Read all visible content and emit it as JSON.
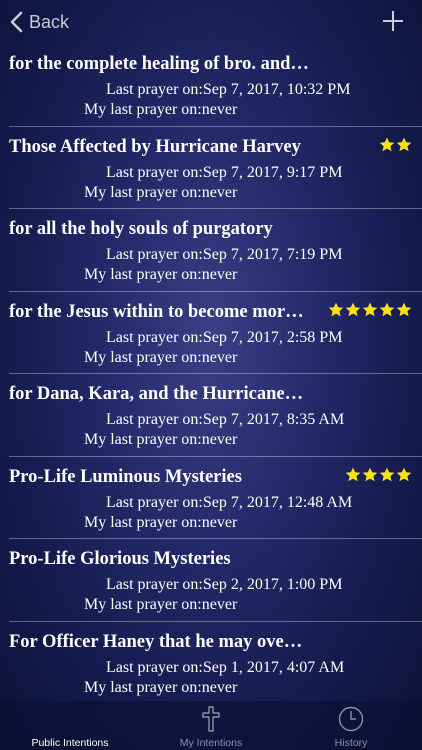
{
  "nav": {
    "back_label": "Back"
  },
  "colors": {
    "star": "#f7e21a",
    "muted": "#8d90a8"
  },
  "intentions": [
    {
      "title": "for the complete healing of bro. and…",
      "stars": 0,
      "last_prayer": "Last prayer on:Sep 7, 2017, 10:32 PM",
      "my_last_prayer": "My last prayer on:never"
    },
    {
      "title": "Those Affected by Hurricane Harvey",
      "stars": 2,
      "last_prayer": "Last prayer on:Sep 7, 2017, 9:17 PM",
      "my_last_prayer": "My last prayer on:never"
    },
    {
      "title": "for all the holy souls of purgatory",
      "stars": 0,
      "last_prayer": "Last prayer on:Sep 7, 2017, 7:19 PM",
      "my_last_prayer": "My last prayer on:never"
    },
    {
      "title": "for the Jesus within to become mor…",
      "stars": 5,
      "last_prayer": "Last prayer on:Sep 7, 2017, 2:58 PM",
      "my_last_prayer": "My last prayer on:never"
    },
    {
      "title": "for Dana, Kara, and the Hurricane…",
      "stars": 0,
      "last_prayer": "Last prayer on:Sep 7, 2017, 8:35 AM",
      "my_last_prayer": "My last prayer on:never"
    },
    {
      "title": "Pro-Life Luminous Mysteries",
      "stars": 4,
      "last_prayer": "Last prayer on:Sep 7, 2017, 12:48 AM",
      "my_last_prayer": "My last prayer on:never"
    },
    {
      "title": "Pro-Life Glorious Mysteries",
      "stars": 0,
      "last_prayer": "Last prayer on:Sep 2, 2017, 1:00 PM",
      "my_last_prayer": "My last prayer on:never"
    },
    {
      "title": "For Officer Haney that he may ove…",
      "stars": 0,
      "last_prayer": "Last prayer on:Sep 1, 2017, 4:07 AM",
      "my_last_prayer": "My last prayer on:never"
    }
  ],
  "tabs": [
    {
      "label": "Public Intentions",
      "icon": "none",
      "active": true
    },
    {
      "label": "My Intentions",
      "icon": "cross-icon",
      "active": false
    },
    {
      "label": "History",
      "icon": "clock-icon",
      "active": false
    }
  ]
}
